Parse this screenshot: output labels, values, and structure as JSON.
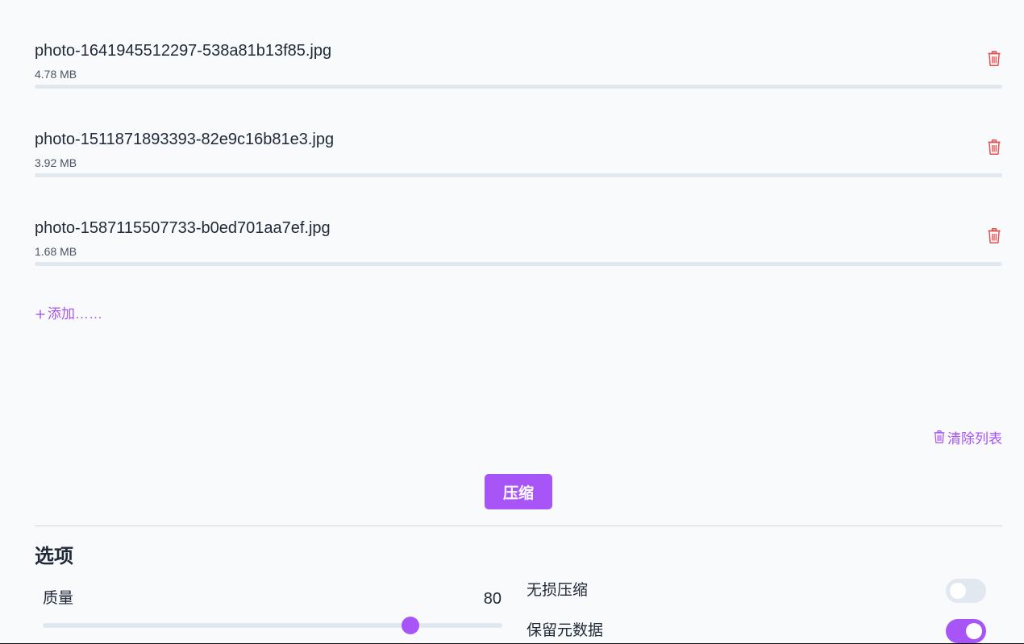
{
  "files": [
    {
      "name": "photo-1641945512297-538a81b13f85.jpg",
      "size": "4.78 MB",
      "delete_icon": "trash-icon"
    },
    {
      "name": "photo-1511871893393-82e9c16b81e3.jpg",
      "size": "3.92 MB",
      "delete_icon": "trash-icon"
    },
    {
      "name": "photo-1587115507733-b0ed701aa7ef.jpg",
      "size": "1.68 MB",
      "delete_icon": "trash-icon"
    }
  ],
  "add": {
    "icon": "plus-icon",
    "label": "添加……"
  },
  "clear": {
    "icon": "trash-icon",
    "label": "清除列表"
  },
  "compress_button": "压缩",
  "options": {
    "title": "选项",
    "quality": {
      "label": "质量",
      "value": 80,
      "display": "80",
      "min": 0,
      "max": 100
    },
    "lossless": {
      "label": "无损压缩",
      "enabled": false
    },
    "keep_metadata": {
      "label": "保留元数据",
      "enabled": true
    }
  },
  "colors": {
    "accent": "#a855f7",
    "danger": "#e05252",
    "track": "#e2e8f0",
    "background": "#f8fafc"
  }
}
